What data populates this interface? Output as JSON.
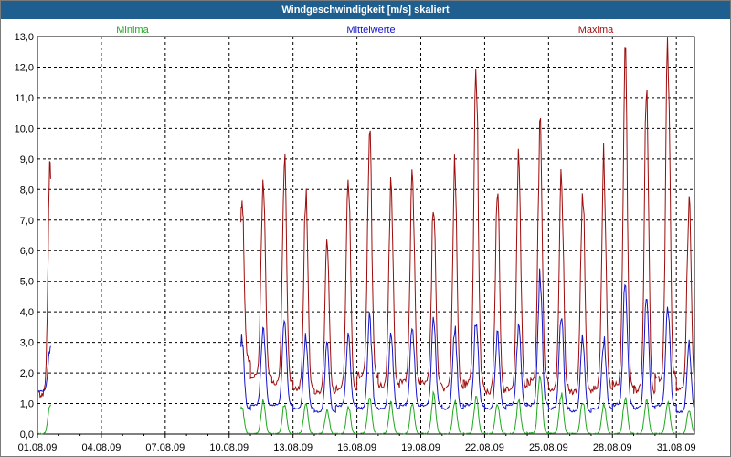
{
  "window": {
    "title": "Windgeschwindigkeit [m/s] skaliert"
  },
  "colors": {
    "min": "#1fa81f",
    "mean": "#1414c8",
    "max": "#9e0b0b",
    "grid": "#000000",
    "frame": "#000000",
    "title_bar": "#1f5f8f"
  },
  "chart_data": {
    "type": "line",
    "title": "Windgeschwindigkeit [m/s] skaliert",
    "ylim": [
      0,
      13
    ],
    "yticks": [
      "0,0",
      "1,0",
      "2,0",
      "3,0",
      "4,0",
      "5,0",
      "6,0",
      "7,0",
      "8,0",
      "9,0",
      "10,0",
      "11,0",
      "12,0",
      "13,0"
    ],
    "xlim": [
      "2009-08-01",
      "2009-08-31"
    ],
    "xticks": [
      "01.08.09",
      "04.08.09",
      "07.08.09",
      "10.08.09",
      "13.08.09",
      "16.08.09",
      "19.08.09",
      "22.08.09",
      "25.08.09",
      "28.08.09",
      "31.08.09"
    ],
    "grid": true,
    "legend": [
      {
        "name": "Minima",
        "position": "left"
      },
      {
        "name": "Mittelwerte",
        "position": "center"
      },
      {
        "name": "Maxima",
        "position": "right"
      }
    ],
    "day_starts": [
      "2009-08-01",
      "2009-08-02",
      "2009-08-03",
      "2009-08-04",
      "2009-08-05",
      "2009-08-06",
      "2009-08-07",
      "2009-08-08",
      "2009-08-09",
      "2009-08-10",
      "2009-08-11",
      "2009-08-12",
      "2009-08-13",
      "2009-08-14",
      "2009-08-15",
      "2009-08-16",
      "2009-08-17",
      "2009-08-18",
      "2009-08-19",
      "2009-08-20",
      "2009-08-21",
      "2009-08-22",
      "2009-08-23",
      "2009-08-24",
      "2009-08-25",
      "2009-08-26",
      "2009-08-27",
      "2009-08-28",
      "2009-08-29",
      "2009-08-30",
      "2009-08-31"
    ],
    "series": [
      {
        "name": "Maxima",
        "daily_peaks": [
          9.0,
          null,
          null,
          null,
          null,
          null,
          null,
          null,
          null,
          7.8,
          8.3,
          8.9,
          7.7,
          6.2,
          8.5,
          9.9,
          8.0,
          9.0,
          7.5,
          8.7,
          11.9,
          8.0,
          8.8,
          10.2,
          8.6,
          8.1,
          9.0,
          12.4,
          11.8,
          13.0,
          7.6
        ],
        "daily_lows": [
          1.2,
          null,
          null,
          null,
          null,
          null,
          null,
          null,
          null,
          2.3,
          1.8,
          1.6,
          1.4,
          1.3,
          1.4,
          1.8,
          1.5,
          1.6,
          1.6,
          1.4,
          1.5,
          1.3,
          1.4,
          1.6,
          1.4,
          1.3,
          1.4,
          1.5,
          1.3,
          1.7,
          1.4
        ]
      },
      {
        "name": "Mittelwerte",
        "daily_peaks": [
          2.8,
          null,
          null,
          null,
          null,
          null,
          null,
          null,
          null,
          3.1,
          3.6,
          3.8,
          3.2,
          2.9,
          3.2,
          3.8,
          3.2,
          3.6,
          3.7,
          3.4,
          3.8,
          3.3,
          3.5,
          5.3,
          3.9,
          3.3,
          3.1,
          5.1,
          4.6,
          4.3,
          2.9
        ],
        "daily_lows": [
          1.4,
          null,
          null,
          null,
          null,
          null,
          null,
          null,
          null,
          0.8,
          0.9,
          0.9,
          0.8,
          0.7,
          0.9,
          0.8,
          0.8,
          0.9,
          0.9,
          0.8,
          0.9,
          0.8,
          0.9,
          0.9,
          0.8,
          0.7,
          0.8,
          0.9,
          0.8,
          0.9,
          0.7
        ]
      },
      {
        "name": "Minima",
        "daily_peaks": [
          1.0,
          null,
          null,
          null,
          null,
          null,
          null,
          null,
          null,
          0.9,
          1.1,
          1.0,
          1.0,
          0.8,
          0.9,
          1.2,
          1.0,
          1.0,
          1.3,
          1.1,
          1.2,
          1.0,
          1.1,
          2.0,
          1.3,
          1.1,
          1.0,
          1.2,
          1.1,
          1.1,
          0.8
        ],
        "daily_lows": [
          0.0,
          null,
          null,
          null,
          null,
          null,
          null,
          null,
          null,
          0.0,
          0.0,
          0.0,
          0.0,
          0.0,
          0.0,
          0.0,
          0.0,
          0.0,
          0.0,
          0.0,
          0.0,
          0.0,
          0.0,
          0.0,
          0.0,
          0.0,
          0.0,
          0.0,
          0.0,
          0.0,
          0.0
        ]
      }
    ]
  }
}
